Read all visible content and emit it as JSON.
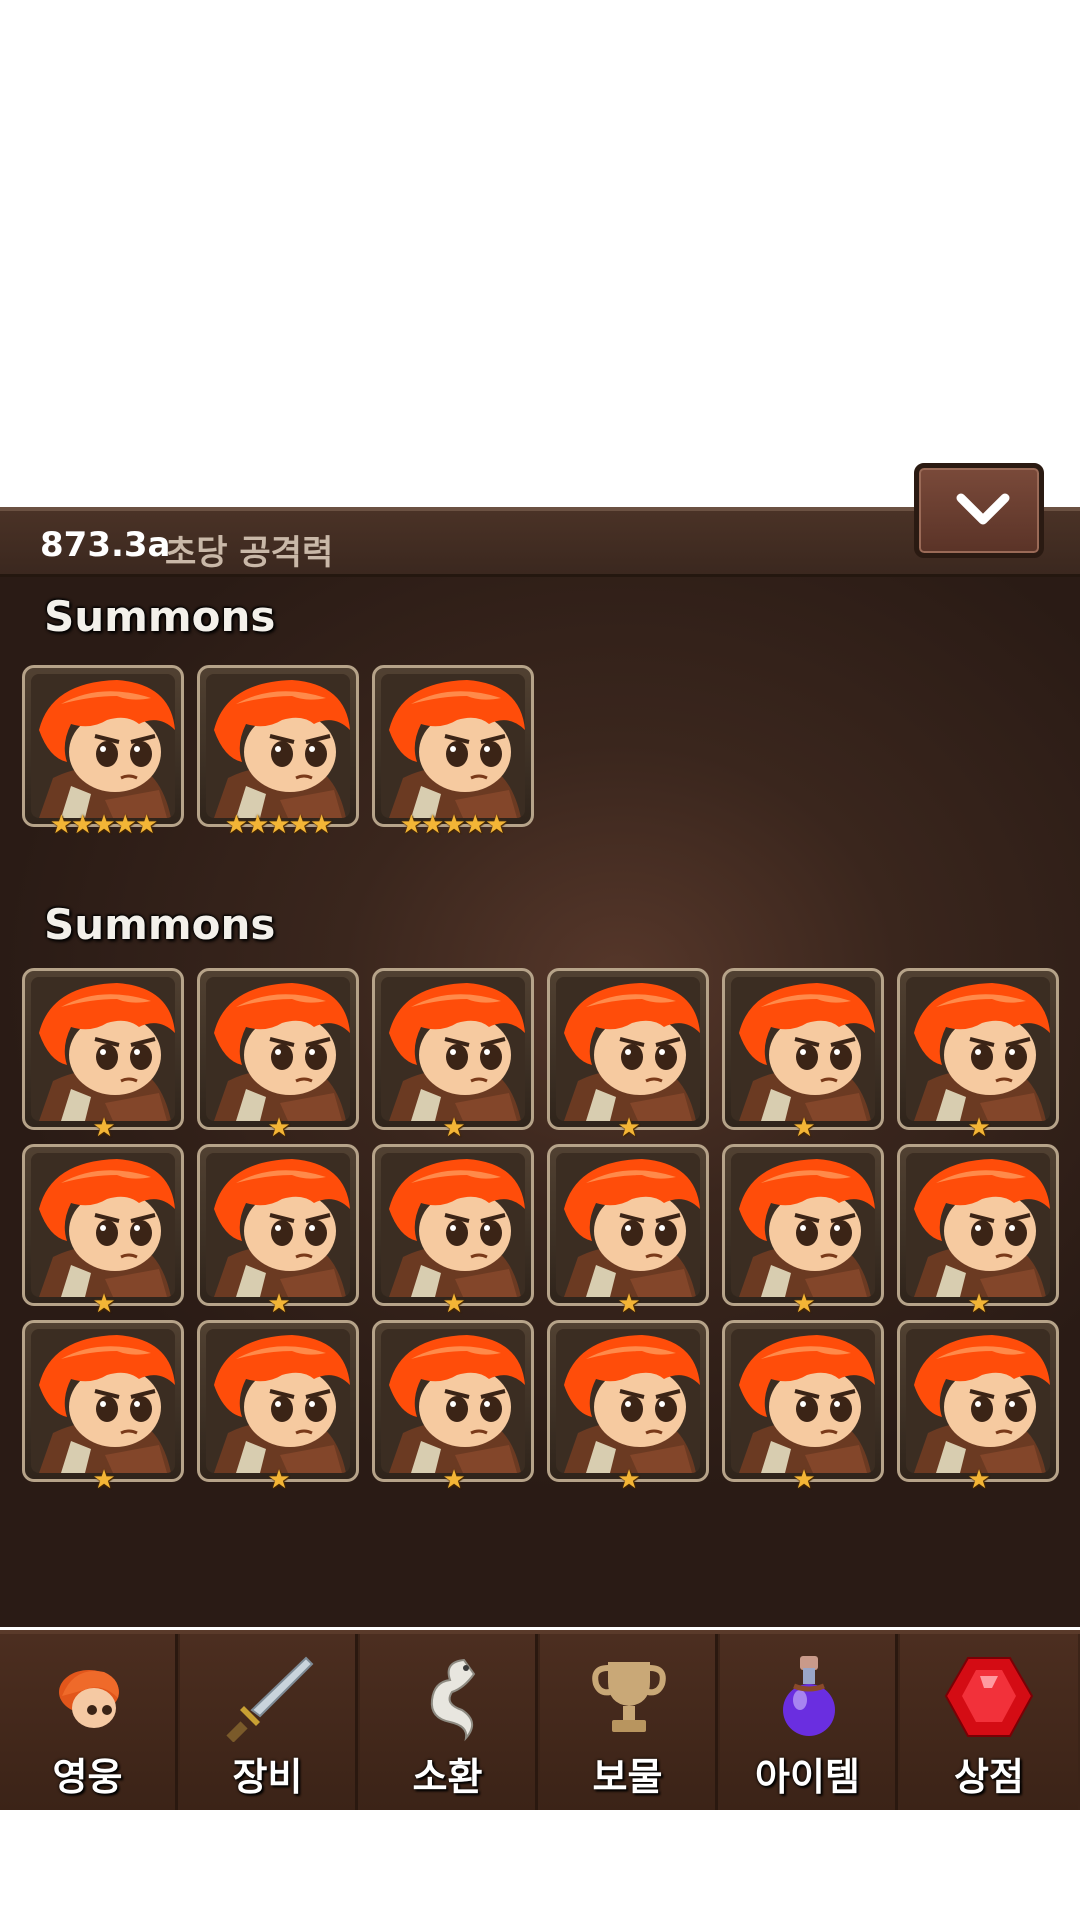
{
  "stat_bar": {
    "value": "873.3a",
    "label": "초당 공격력"
  },
  "sections": [
    {
      "title": "Summons",
      "hero_count": 3,
      "stars_per_hero": 5
    },
    {
      "title": "Summons",
      "hero_count": 18,
      "stars_per_hero": 1
    }
  ],
  "nav": [
    {
      "label": "영웅",
      "icon": "hero-icon"
    },
    {
      "label": "장비",
      "icon": "sword-icon"
    },
    {
      "label": "소환",
      "icon": "dragon-icon"
    },
    {
      "label": "보물",
      "icon": "trophy-icon"
    },
    {
      "label": "아이템",
      "icon": "potion-icon"
    },
    {
      "label": "상점",
      "icon": "gem-icon"
    }
  ],
  "colors": {
    "star": "#f3b536",
    "hair": "#ff4d0a",
    "panel": "#2a1b15"
  }
}
